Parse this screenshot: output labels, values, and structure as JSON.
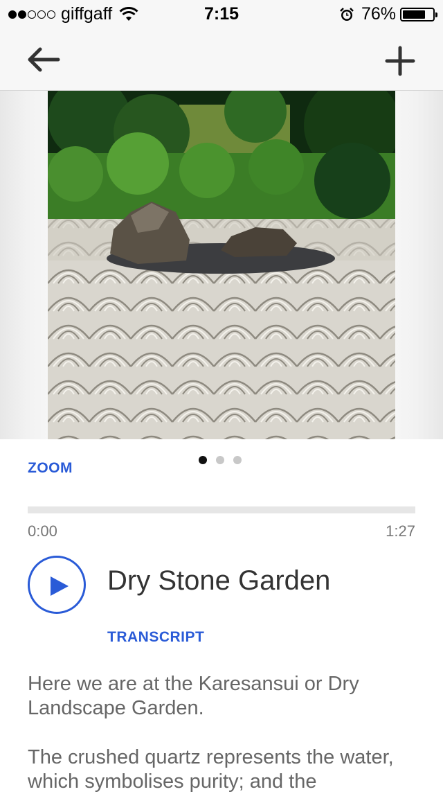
{
  "status_bar": {
    "signal_filled": 2,
    "signal_total": 5,
    "carrier": "giffgaff",
    "time": "7:15",
    "battery_percent_label": "76%",
    "battery_level": 0.76,
    "icons": [
      "wifi-icon",
      "alarm-icon",
      "battery-icon"
    ]
  },
  "nav": {
    "back_icon": "arrow-left-icon",
    "add_icon": "plus-icon"
  },
  "hero": {
    "image_subject": "raked gravel dry garden with stones",
    "carousel_total": 3,
    "carousel_active": 1
  },
  "zoom_label": "ZOOM",
  "audio": {
    "elapsed": "0:00",
    "total": "1:27",
    "progress": 0,
    "accent_color": "#2a5bd7",
    "play_icon": "play-icon"
  },
  "track": {
    "title": "Dry Stone Garden",
    "transcript_label": "TRANSCRIPT"
  },
  "transcript": {
    "paragraphs": [
      "Here we are at the Karesansui or Dry Landscape Garden.",
      "The crushed quartz represents the water, which symbolises purity; and the"
    ]
  }
}
